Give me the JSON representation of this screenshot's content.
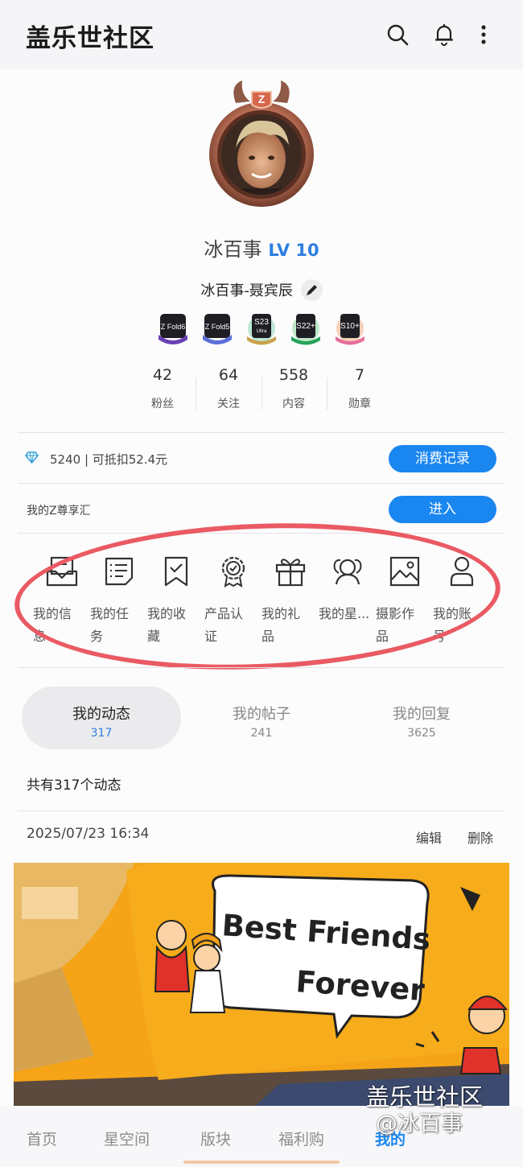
{
  "header": {
    "app_title": "盖乐世社区",
    "icons": [
      "search-icon",
      "bell-icon",
      "more-vertical-icon"
    ]
  },
  "profile": {
    "username": "冰百事",
    "level": "LV 10",
    "nickname": "冰百事-聂宾辰",
    "badges": [
      {
        "name": "zfold6-badge",
        "text": "Z Fold6",
        "color": "#6a3fb5"
      },
      {
        "name": "zfold5-badge",
        "text": "Z Fold5",
        "color": "#5b6fd6"
      },
      {
        "name": "s23-ultra-badge",
        "text": "S23",
        "subtext": "Ultra",
        "color": "#2f9e73"
      },
      {
        "name": "s22plus-badge",
        "text": "S22+",
        "color": "#27a35a"
      },
      {
        "name": "s10plus-badge",
        "text": "S10+",
        "color": "#e56f9b"
      }
    ],
    "stats": [
      {
        "value": "42",
        "label": "粉丝"
      },
      {
        "value": "64",
        "label": "关注"
      },
      {
        "value": "558",
        "label": "内容"
      },
      {
        "value": "7",
        "label": "勋章"
      }
    ]
  },
  "points": {
    "text": "5240 | 可抵扣52.4元",
    "button": "消费记录"
  },
  "zhub": {
    "label": "我的Z尊享汇",
    "button": "进入"
  },
  "menu": [
    {
      "icon": "inbox-icon",
      "label": "我的信息"
    },
    {
      "icon": "task-list-icon",
      "label": "我的任务"
    },
    {
      "icon": "bookmark-icon",
      "label": "我的收藏"
    },
    {
      "icon": "certified-badge-icon",
      "label": "产品认证"
    },
    {
      "icon": "gift-icon",
      "label": "我的礼品"
    },
    {
      "icon": "group-icon",
      "label": "我的星..."
    },
    {
      "icon": "image-icon",
      "label": "摄影作品"
    },
    {
      "icon": "person-icon",
      "label": "我的账号"
    }
  ],
  "tabs": [
    {
      "label": "我的动态",
      "count": "317",
      "active": true
    },
    {
      "label": "我的帖子",
      "count": "241",
      "active": false
    },
    {
      "label": "我的回复",
      "count": "3625",
      "active": false
    }
  ],
  "feed": {
    "total": "共有317个动态",
    "post": {
      "date": "2025/07/23 16:34",
      "edit": "编辑",
      "delete": "删除",
      "image_text": [
        "Best Friends",
        "Forever"
      ]
    }
  },
  "bottom_nav": [
    {
      "label": "首页",
      "active": false
    },
    {
      "label": "星空间",
      "active": false
    },
    {
      "label": "版块",
      "active": false
    },
    {
      "label": "福利购",
      "active": false
    },
    {
      "label": "我的",
      "active": true
    }
  ],
  "watermark": [
    "盖乐世社区",
    "@冰百事"
  ],
  "colors": {
    "accent": "#1a86f0",
    "highlight_ring": "#ea5a63",
    "level": "#2e7fe0"
  }
}
